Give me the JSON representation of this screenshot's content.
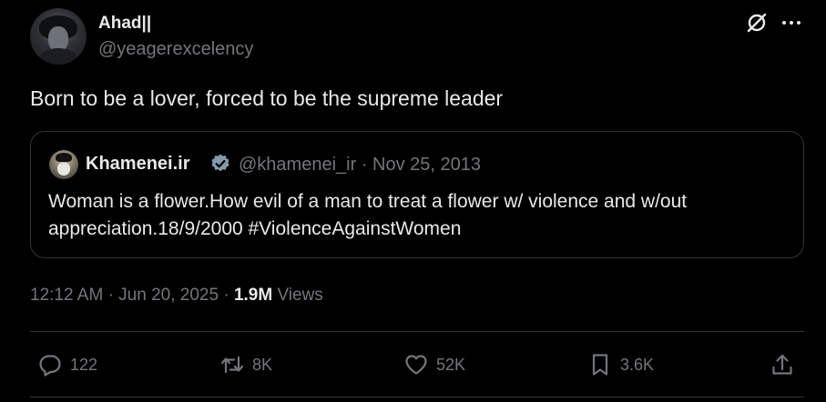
{
  "author": {
    "display_name": "Ahad||",
    "handle": "@yeagerexcelency"
  },
  "tweet": {
    "text": "Born to be a lover, forced to be the supreme leader"
  },
  "quoted_tweet": {
    "display_name": "Khamenei.ir",
    "handle": "@khamenei_ir",
    "date": "Nov 25, 2013",
    "separator": "·",
    "text": "Woman is a flower.How evil of a man to treat a flower w/ violence and w/out appreciation.18/9/2000 #ViolenceAgainstWomen",
    "verified_color": "#829aab"
  },
  "meta": {
    "time": "12:12 AM",
    "date": "Jun 20, 2025",
    "separator": "·",
    "views_count": "1.9M",
    "views_label": "Views"
  },
  "actions": {
    "reply_count": "122",
    "repost_count": "8K",
    "like_count": "52K",
    "bookmark_count": "3.6K"
  },
  "icons": [
    "grok-icon",
    "more-icon",
    "verified-icon",
    "reply-icon",
    "repost-icon",
    "like-icon",
    "bookmark-icon",
    "share-icon"
  ],
  "colors": {
    "background": "#000000",
    "text": "#e7e9ea",
    "secondary_text": "#71767b",
    "border": "#2f3336"
  }
}
